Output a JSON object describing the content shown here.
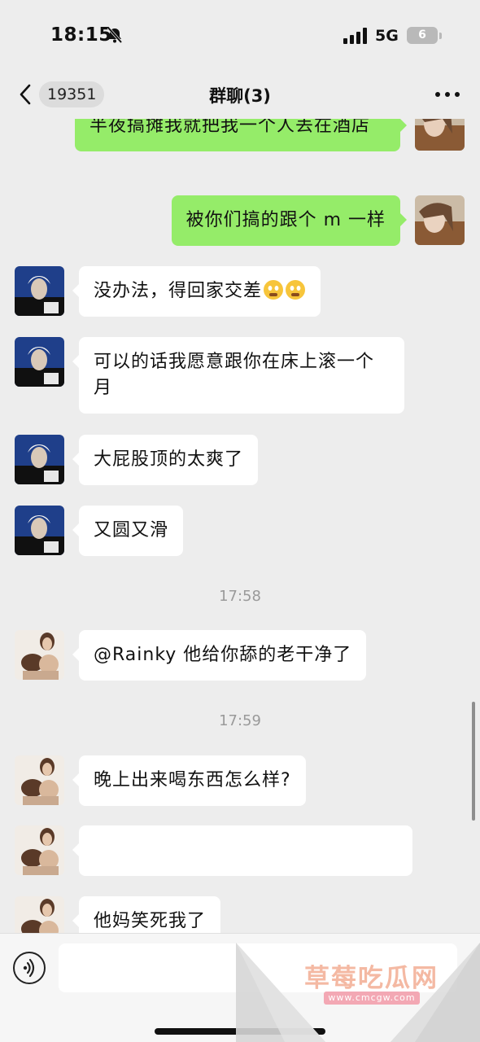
{
  "status_bar": {
    "time": "18:15",
    "network": "5G",
    "battery": "6"
  },
  "header": {
    "back_count": "19351",
    "title": "群聊(3)"
  },
  "messages": [
    {
      "type": "out",
      "text": "半夜搞摊我就把我一个人丢在酒店"
    },
    {
      "type": "out",
      "text": "被你们搞的跟个 m 一样"
    },
    {
      "type": "in",
      "text": "没办法，得回家交差"
    },
    {
      "type": "in",
      "text": "可以的话我愿意跟你在床上滚一个月"
    },
    {
      "type": "in",
      "text": "大屁股顶的太爽了"
    },
    {
      "type": "in",
      "text": "又圆又滑"
    },
    {
      "type": "time",
      "text": "17:58"
    },
    {
      "type": "in",
      "text": "@Rainky 他给你舔的老干净了"
    },
    {
      "type": "time",
      "text": "17:59"
    },
    {
      "type": "in",
      "text": "晚上出来喝东西怎么样?"
    },
    {
      "type": "in",
      "text": ""
    },
    {
      "type": "in",
      "text": "他妈笑死我了"
    }
  ],
  "input": {
    "placeholder": ""
  },
  "watermark": {
    "text": "草莓吃瓜网",
    "url": "www.cmcgw.com"
  },
  "colors": {
    "background": "#ededed",
    "outgoing_bubble": "#95ec69",
    "incoming_bubble": "#ffffff"
  },
  "icons": [
    "chevron-left-icon",
    "more-icon",
    "bell-slash-icon",
    "signal-icon",
    "voice-icon"
  ]
}
